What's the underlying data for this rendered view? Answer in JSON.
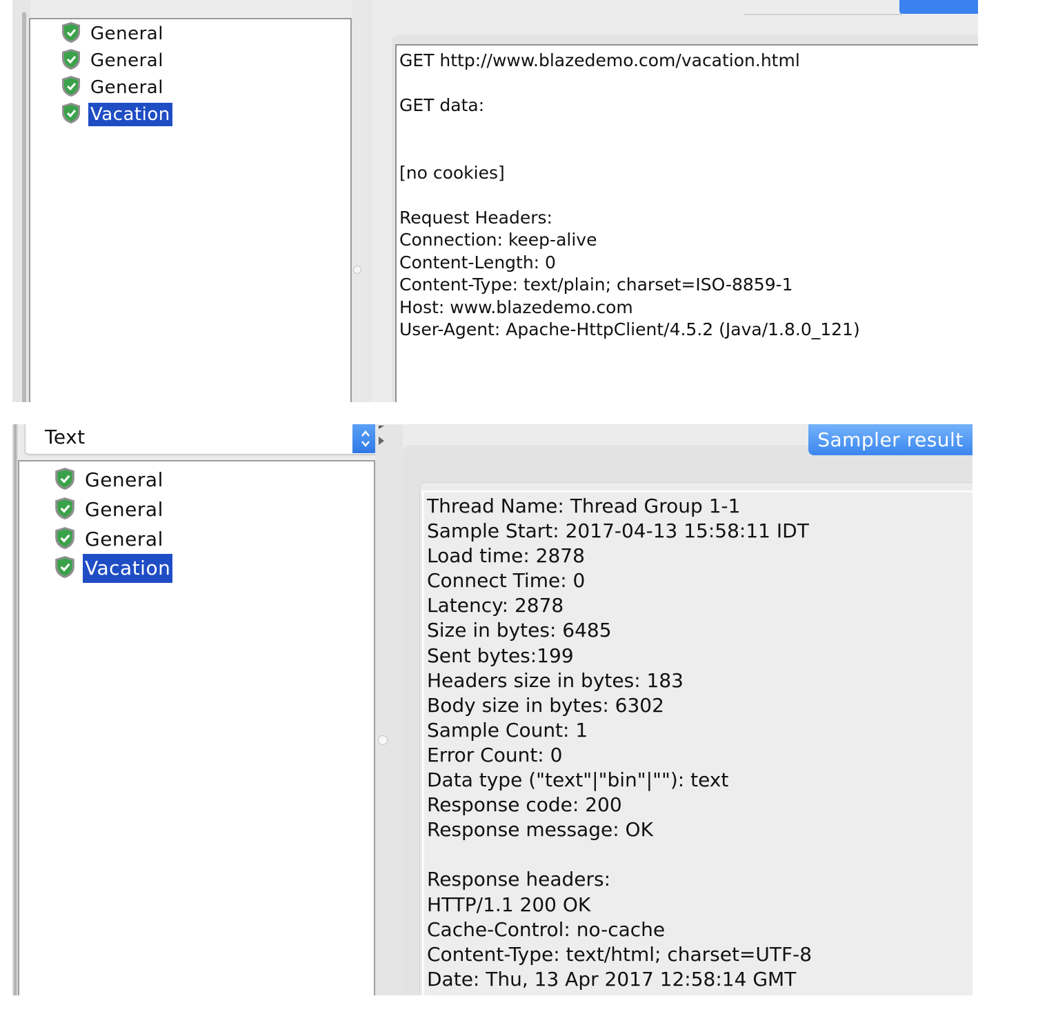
{
  "top": {
    "tree_items": [
      {
        "label": "General",
        "selected": false
      },
      {
        "label": "General",
        "selected": false
      },
      {
        "label": "General",
        "selected": false
      },
      {
        "label": "Vacation",
        "selected": true
      }
    ],
    "request_lines": [
      "GET http://www.blazedemo.com/vacation.html",
      "",
      "GET data:",
      "",
      "",
      "[no cookies]",
      "",
      "Request Headers:",
      "Connection: keep-alive",
      "Content-Length: 0",
      "Content-Type: text/plain; charset=ISO-8859-1",
      "Host: www.blazedemo.com",
      "User-Agent: Apache-HttpClient/4.5.2 (Java/1.8.0_121)"
    ]
  },
  "bottom": {
    "renderer_select": {
      "value": "Text"
    },
    "sampler_result_tab": "Sampler result",
    "tree_items": [
      {
        "label": "General",
        "selected": false
      },
      {
        "label": "General",
        "selected": false
      },
      {
        "label": "General",
        "selected": false
      },
      {
        "label": "Vacation",
        "selected": true
      }
    ],
    "result_lines": [
      "Thread Name: Thread Group 1-1",
      "Sample Start: 2017-04-13 15:58:11 IDT",
      "Load time: 2878",
      "Connect Time: 0",
      "Latency: 2878",
      "Size in bytes: 6485",
      "Sent bytes:199",
      "Headers size in bytes: 183",
      "Body size in bytes: 6302",
      "Sample Count: 1",
      "Error Count: 0",
      "Data type (\"text\"|\"bin\"|\"\"): text",
      "Response code: 200",
      "Response message: OK",
      "",
      "Response headers:",
      "HTTP/1.1 200 OK",
      "Cache-Control: no-cache",
      "Content-Type: text/html; charset=UTF-8",
      "Date: Thu, 13 Apr 2017 12:58:14 GMT"
    ]
  },
  "icons": {
    "tree_item_icon": "green-shield-check-icon",
    "select_icon": "up-down-chevron-icon",
    "collapse_icon": "triangle-arrow-icon"
  },
  "colors": {
    "selection": "#1f4dc4",
    "accent_button": "#3a86ee",
    "shield_green": "#3aa34a"
  }
}
